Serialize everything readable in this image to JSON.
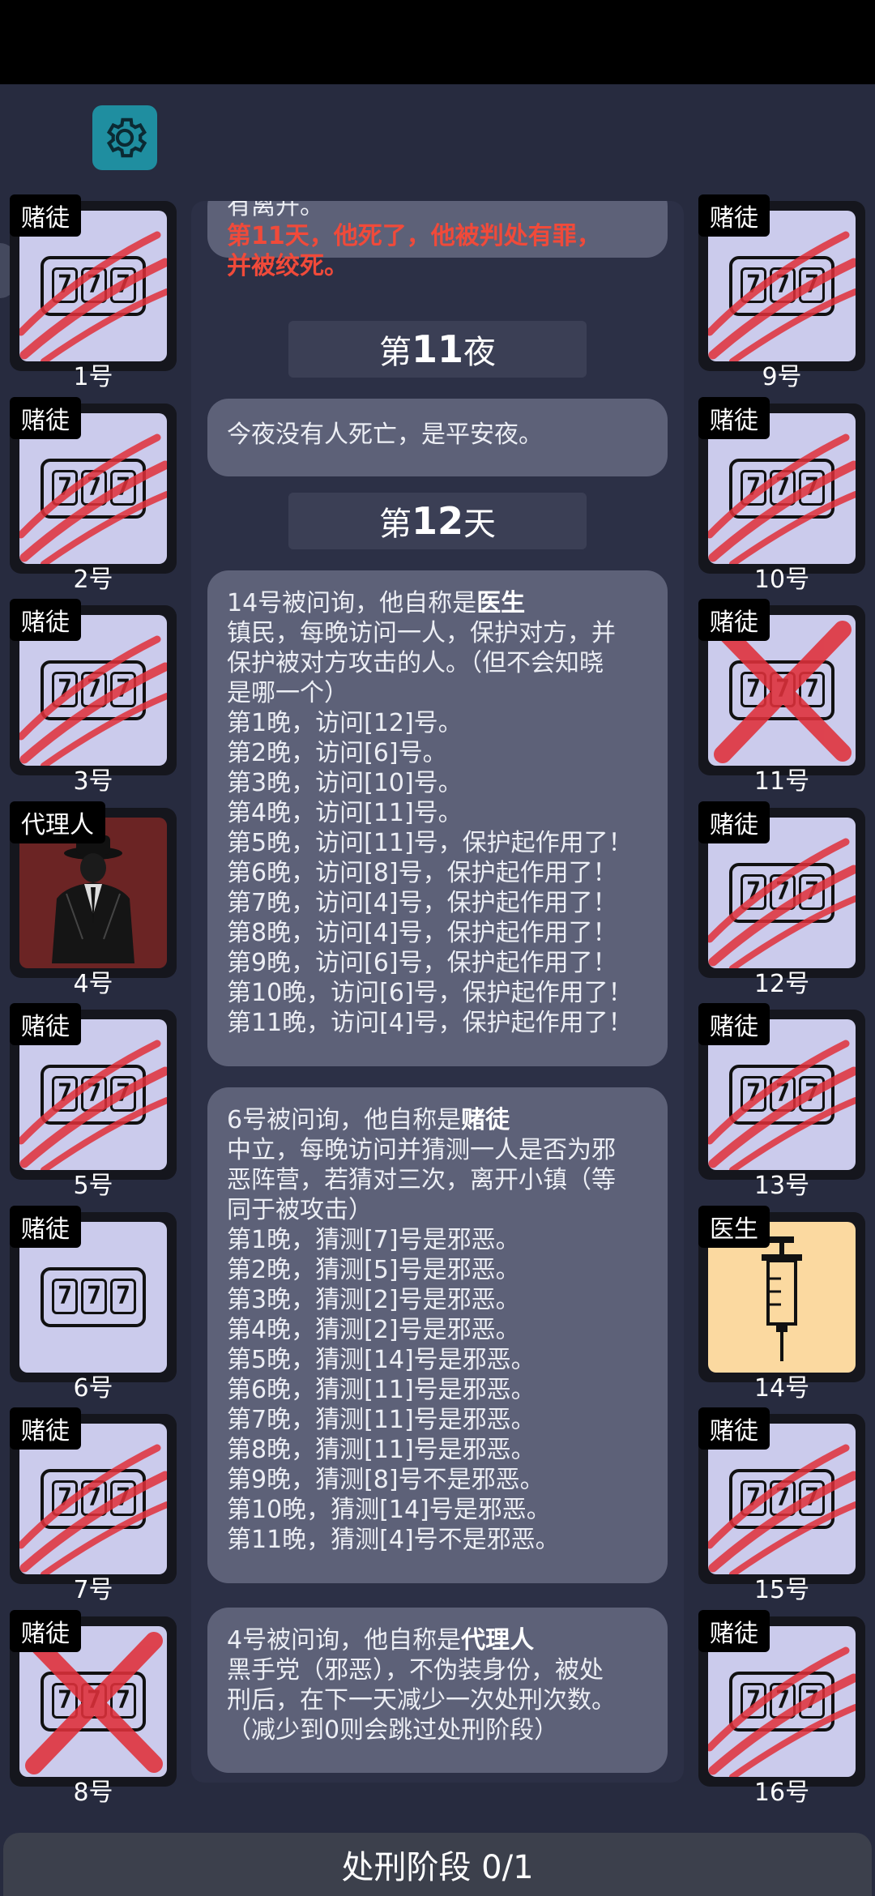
{
  "app": {
    "settings_icon": "gear-icon"
  },
  "log": {
    "m0": {
      "l1": "有离开。",
      "l2": "第11天，他死了，他被判处有罪，",
      "l3": "并被绞死。"
    },
    "night11": {
      "pre": "第",
      "num": "11",
      "post": "夜"
    },
    "m1": {
      "l1": "今夜没有人死亡，是平安夜。"
    },
    "day12": {
      "pre": "第",
      "num": "12",
      "post": "天"
    },
    "m2": {
      "head_pre": "14号被问询，他自称是",
      "head_role": "医生",
      "lines": [
        "镇民，每晚访问一人，保护对方，并",
        "保护被对方攻击的人。（但不会知晓",
        "是哪一个）",
        "第1晚，访问[12]号。",
        "第2晚，访问[6]号。",
        "第3晚，访问[10]号。",
        "第4晚，访问[11]号。",
        "第5晚，访问[11]号，保护起作用了！",
        "第6晚，访问[8]号，保护起作用了！",
        "第7晚，访问[4]号，保护起作用了！",
        "第8晚，访问[4]号，保护起作用了！",
        "第9晚，访问[6]号，保护起作用了！",
        "第10晚，访问[6]号，保护起作用了！",
        "第11晚，访问[4]号，保护起作用了！"
      ]
    },
    "m3": {
      "head_pre": "6号被问询，他自称是",
      "head_role": "赌徒",
      "lines": [
        "中立，每晚访问并猜测一人是否为邪",
        "恶阵营，若猜对三次，离开小镇（等",
        "同于被攻击）",
        "第1晚，猜测[7]号是邪恶。",
        "第2晚，猜测[5]号是邪恶。",
        "第3晚，猜测[2]号是邪恶。",
        "第4晚，猜测[2]号是邪恶。",
        "第5晚，猜测[14]号是邪恶。",
        "第6晚，猜测[11]号是邪恶。",
        "第7晚，猜测[11]号是邪恶。",
        "第8晚，猜测[11]号是邪恶。",
        "第9晚，猜测[8]号不是邪恶。",
        "第10晚，猜测[14]号是邪恶。",
        "第11晚，猜测[4]号不是邪恶。"
      ]
    },
    "m4": {
      "head_pre": "4号被问询，他自称是",
      "head_role": "代理人",
      "lines": [
        "黑手党（邪恶），不伪装身份，被处",
        "刑后，在下一天减少一次处刑次数。",
        "（减少到0则会跳过处刑阶段）"
      ]
    }
  },
  "players": [
    {
      "num": "1号",
      "role": "赌徒",
      "status": "scratched",
      "art": "slot-777",
      "bg": "#cbcbec"
    },
    {
      "num": "2号",
      "role": "赌徒",
      "status": "scratched",
      "art": "slot-777",
      "bg": "#cbcbec"
    },
    {
      "num": "3号",
      "role": "赌徒",
      "status": "scratched",
      "art": "slot-777",
      "bg": "#cbcbec"
    },
    {
      "num": "4号",
      "role": "代理人",
      "status": "alive",
      "art": "suit-man",
      "bg": "#6b2424"
    },
    {
      "num": "5号",
      "role": "赌徒",
      "status": "scratched",
      "art": "slot-777",
      "bg": "#cbcbec"
    },
    {
      "num": "6号",
      "role": "赌徒",
      "status": "alive",
      "art": "slot-777",
      "bg": "#cbcbec"
    },
    {
      "num": "7号",
      "role": "赌徒",
      "status": "scratched",
      "art": "slot-777",
      "bg": "#cbcbec"
    },
    {
      "num": "8号",
      "role": "赌徒",
      "status": "crossed",
      "art": "slot-777",
      "bg": "#cbcbec"
    },
    {
      "num": "9号",
      "role": "赌徒",
      "status": "scratched",
      "art": "slot-777",
      "bg": "#cbcbec"
    },
    {
      "num": "10号",
      "role": "赌徒",
      "status": "scratched",
      "art": "slot-777",
      "bg": "#cbcbec"
    },
    {
      "num": "11号",
      "role": "赌徒",
      "status": "crossed",
      "art": "slot-777",
      "bg": "#cbcbec"
    },
    {
      "num": "12号",
      "role": "赌徒",
      "status": "scratched",
      "art": "slot-777",
      "bg": "#cbcbec"
    },
    {
      "num": "13号",
      "role": "赌徒",
      "status": "scratched",
      "art": "slot-777",
      "bg": "#cbcbec"
    },
    {
      "num": "14号",
      "role": "医生",
      "status": "alive",
      "art": "syringe",
      "bg": "#fbd9a0"
    },
    {
      "num": "15号",
      "role": "赌徒",
      "status": "scratched",
      "art": "slot-777",
      "bg": "#cbcbec"
    },
    {
      "num": "16号",
      "role": "赌徒",
      "status": "scratched",
      "art": "slot-777",
      "bg": "#cbcbec"
    }
  ],
  "slot_digits": "777",
  "phase": {
    "label": "处刑阶段 0/1"
  },
  "colors": {
    "scratch": "#e0303a",
    "accent": "#1f8ea0"
  }
}
